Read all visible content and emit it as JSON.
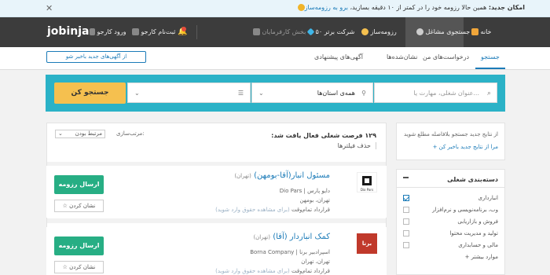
{
  "announcement": {
    "prefix": "امکان جدید:",
    "text": " همین حالا رزومه خود را در کمتر از ۱۰ دقیقه بسازید، ",
    "link": "برو به رزومه‌ساز"
  },
  "nav": {
    "home": "خانه",
    "job_search": "جستجوی مشاغل",
    "resume_builder": "رزومه‌ساز",
    "top50": "۵۰ شرکت برتر",
    "employers": "بخش کارفرمایان",
    "signup": "ثبت‌نام کارجو",
    "login": "ورود کارجو",
    "logo": "jobinja"
  },
  "subnav": {
    "tabs": [
      "جستجو",
      "درخواست‌های من",
      "نشان‌شده‌ها",
      "آگهی‌های پیشنهادی"
    ],
    "notify_button": "از آگهی‌های جدید باخبر شو"
  },
  "search": {
    "keyword_placeholder": "عنوان شغلی، مهارت یا...",
    "province_value": "همه‌ی استان‌ها",
    "category_value": "",
    "extra_value": "",
    "button": "جستجو کن"
  },
  "results": {
    "found_text": "۱۲۹ فرصت شغلی فعال یافت شد:",
    "clear_filters": "حذف فیلترها",
    "sort_label": "مرتب‌سازی:",
    "sort_value": "مرتبط بودن"
  },
  "jobs": [
    {
      "title": "مسئول انبار(آقا-بومهن)",
      "location_tag": "(تهران)",
      "company": "دایو پارس | Dio Pars",
      "city": "تهران، بومهن",
      "contract": "قرارداد تمام‌وقت",
      "salary_note": "(برای مشاهده حقوق وارد شوید)",
      "logo_text": "Dio Pars",
      "apply": "ارسال رزومه",
      "save": "نشان کردن"
    },
    {
      "title": "کمک انباردار (آقا)",
      "location_tag": "(تهران)",
      "company": "اسپرادبیر برنا | Borna Company",
      "city": "تهران، تهران",
      "contract": "قرارداد تمام‌وقت",
      "salary_note": "(برای مشاهده حقوق وارد شوید)",
      "logo_text": "برنا",
      "apply": "ارسال رزومه",
      "save": "نشان کردن"
    }
  ],
  "sidebar": {
    "alert_text": "از نتایج جدید جستجو بلافاصله مطلع شوید",
    "alert_link": "+ مرا از نتایج جدید باخبر کن",
    "category_title": "دسته‌بندی شغلی",
    "categories": [
      {
        "label": "انبارداری",
        "checked": true
      },
      {
        "label": "وب،‌ برنامه‌نویسی و نرم‌افزار",
        "checked": false
      },
      {
        "label": "فروش و بازاریابی",
        "checked": false
      },
      {
        "label": "تولید و مدیریت محتوا",
        "checked": false
      },
      {
        "label": "مالی و حسابداری",
        "checked": false
      }
    ],
    "more_link": "+ موارد بیشتر"
  },
  "colors": {
    "nav_bg": "#3c3c3c",
    "accent": "#1b7bb8",
    "search_band": "#2bb2c7",
    "search_button": "#f5c04f",
    "apply_button": "#27ae84"
  }
}
